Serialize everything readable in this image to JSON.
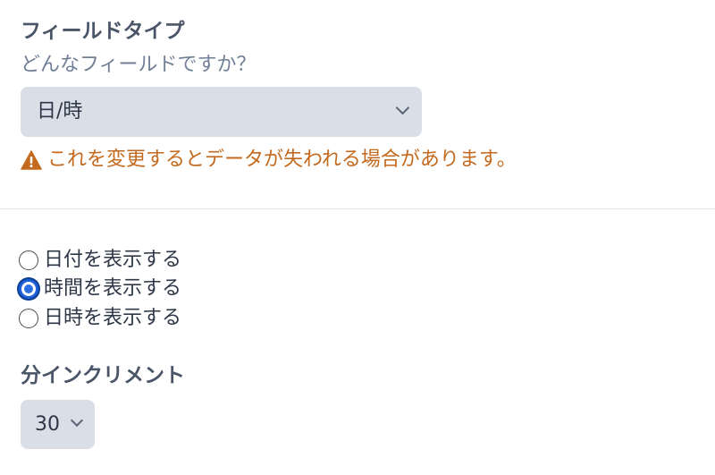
{
  "field_type": {
    "title": "フィールドタイプ",
    "help": "どんなフィールドですか？",
    "selected": "日/時",
    "warning": "これを変更するとデータが失われる場合があります。"
  },
  "display_options": [
    {
      "label": "日付を表示する",
      "checked": false
    },
    {
      "label": "時間を表示する",
      "checked": true
    },
    {
      "label": "日時を表示する",
      "checked": false
    }
  ],
  "minute_increment": {
    "title": "分インクリメント",
    "selected": "30"
  },
  "colors": {
    "warning": "#c36a1f",
    "select_background": "#d9dee7",
    "radio_accent": "#2f6fe4"
  },
  "icons": {
    "warning": "warning-triangle-icon",
    "dropdown": "chevron-down-icon"
  }
}
